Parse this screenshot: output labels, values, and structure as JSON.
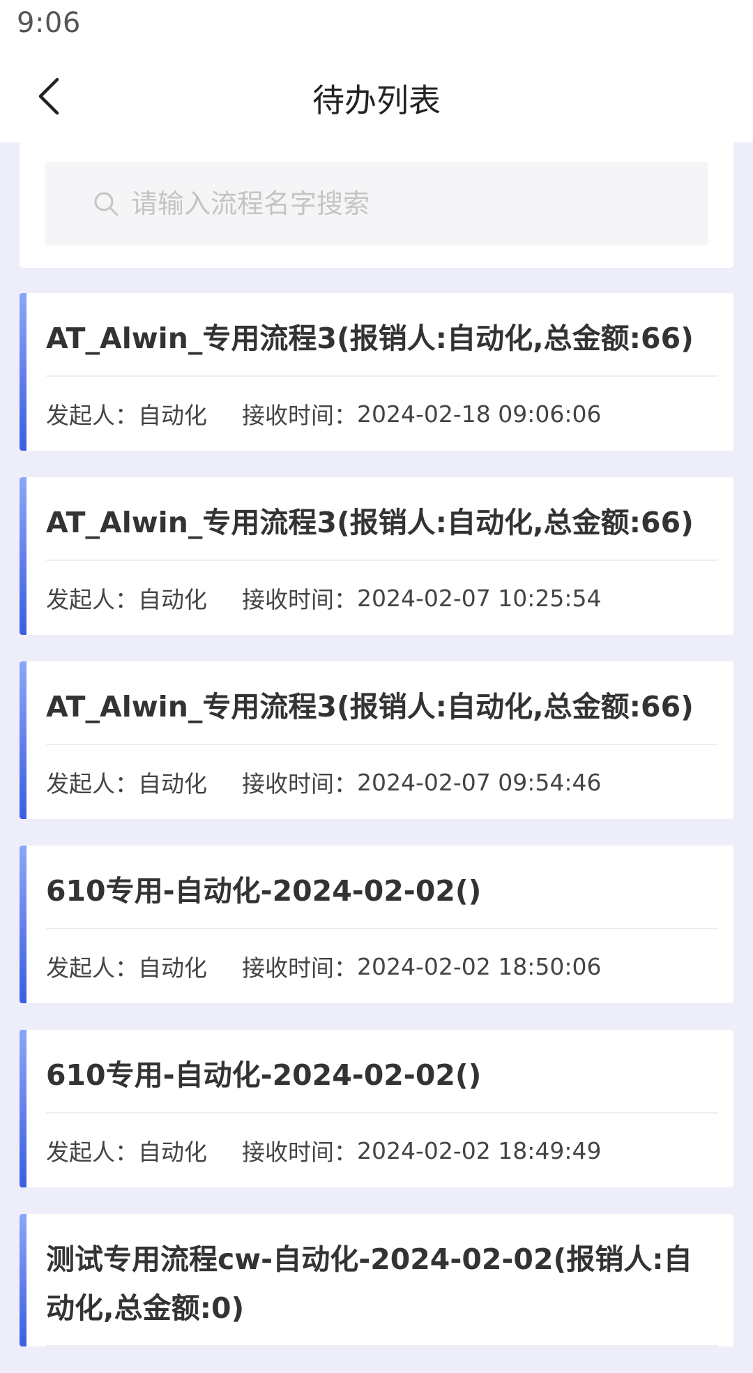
{
  "status_bar": {
    "time": "9:06"
  },
  "header": {
    "title": "待办列表"
  },
  "search": {
    "placeholder": "请输入流程名字搜索"
  },
  "labels": {
    "initiator": "发起人：",
    "received_time": "接收时间："
  },
  "colors": {
    "accent_top": "#8aa6f7",
    "accent_bottom": "#3b5de3",
    "background": "#eeeefb"
  },
  "items": [
    {
      "title": "AT_Alwin_专用流程3(报销人:自动化,总金额:66)",
      "initiator": "自动化",
      "received_time": "2024-02-18 09:06:06"
    },
    {
      "title": "AT_Alwin_专用流程3(报销人:自动化,总金额:66)",
      "initiator": "自动化",
      "received_time": "2024-02-07 10:25:54"
    },
    {
      "title": "AT_Alwin_专用流程3(报销人:自动化,总金额:66)",
      "initiator": "自动化",
      "received_time": "2024-02-07 09:54:46"
    },
    {
      "title": "610专用-自动化-2024-02-02()",
      "initiator": "自动化",
      "received_time": "2024-02-02 18:50:06"
    },
    {
      "title": "610专用-自动化-2024-02-02()",
      "initiator": "自动化",
      "received_time": "2024-02-02 18:49:49"
    },
    {
      "title": "测试专用流程cw-自动化-2024-02-02(报销人:自动化,总金额:0)",
      "initiator": "",
      "received_time": ""
    }
  ]
}
